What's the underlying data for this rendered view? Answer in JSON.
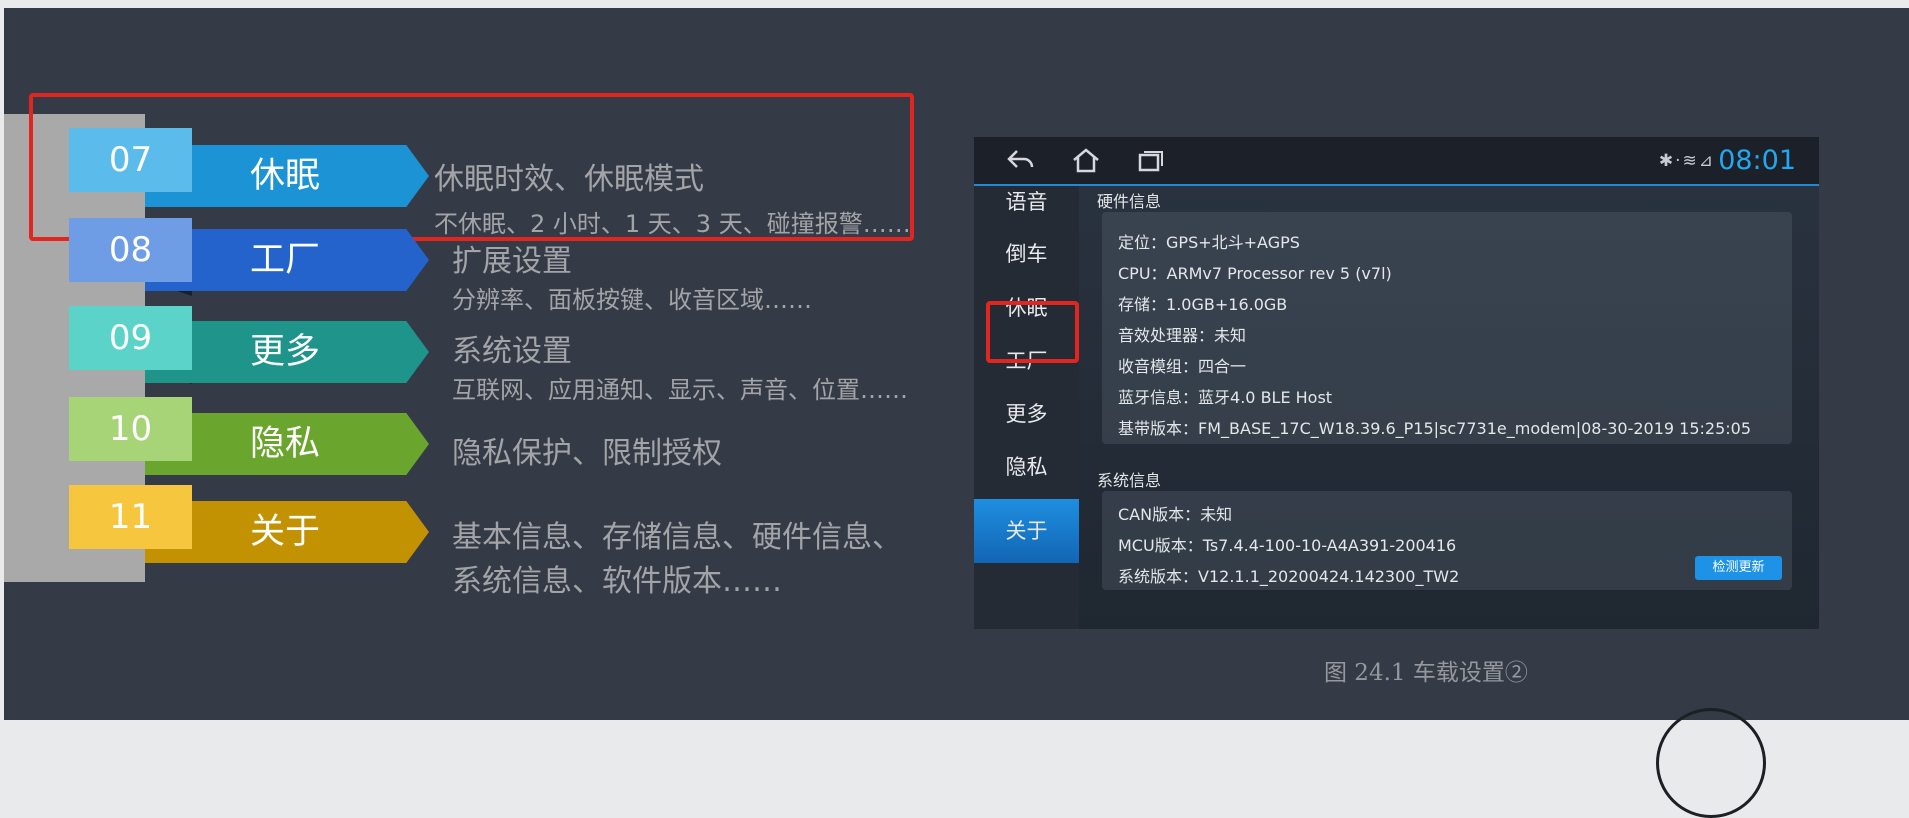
{
  "menu_items": [
    {
      "num": "07",
      "title": "休眠",
      "line1": "休眠时效、休眠模式",
      "line2": "不休眠、2 小时、1 天、3 天、碰撞报警……",
      "num_color": "#5bbcec",
      "ribbon_color": "#1b93d4"
    },
    {
      "num": "08",
      "title": "工厂",
      "line1": "扩展设置",
      "line2": "分辨率、面板按键、收音区域……",
      "num_color": "#6e9de6",
      "ribbon_color": "#2563cc"
    },
    {
      "num": "09",
      "title": "更多",
      "line1": "系统设置",
      "line2": "互联网、应用通知、显示、声音、位置……",
      "num_color": "#5cd3c8",
      "ribbon_color": "#1f948a"
    },
    {
      "num": "10",
      "title": "隐私",
      "line1": "隐私保护、限制授权",
      "line2": "",
      "num_color": "#a6d477",
      "ribbon_color": "#6aa52d"
    },
    {
      "num": "11",
      "title": "关于",
      "line1": "基本信息、存储信息、硬件信息、",
      "line2": "系统信息、软件版本……",
      "num_color": "#f7c63f",
      "ribbon_color": "#c29203"
    }
  ],
  "screenshot": {
    "status": {
      "time": "08:01",
      "net_icons": "✱·≋⊿"
    },
    "sidebar": [
      "语音",
      "倒车",
      "休眠",
      "工厂",
      "更多",
      "隐私",
      "关于"
    ],
    "hardware": {
      "title": "硬件信息",
      "rows": [
        {
          "k": "定位",
          "v": "GPS+北斗+AGPS"
        },
        {
          "k": "CPU",
          "v": "ARMv7 Processor rev 5 (v7l)"
        },
        {
          "k": "存储",
          "v": "1.0GB+16.0GB"
        },
        {
          "k": "音效处理器",
          "v": "未知"
        },
        {
          "k": "收音模组",
          "v": "四合一"
        },
        {
          "k": "蓝牙信息",
          "v": "蓝牙4.0 BLE Host"
        },
        {
          "k": "基带版本",
          "v": "FM_BASE_17C_W18.39.6_P15|sc7731e_modem|08-30-2019 15:25:05"
        }
      ]
    },
    "system": {
      "title": "系统信息",
      "rows": [
        {
          "k": "CAN版本",
          "v": "未知"
        },
        {
          "k": "MCU版本",
          "v": "Ts7.4.4-100-10-A4A391-200416"
        },
        {
          "k": "系统版本",
          "v": "V12.1.1_20200424.142300_TW2"
        }
      ],
      "update_button": "检测更新"
    }
  },
  "caption": "图 24.1  车载设置②",
  "colors": {
    "highlight": "#e12521",
    "slide_bg": "#343a46",
    "accent": "#1d8bd6"
  }
}
